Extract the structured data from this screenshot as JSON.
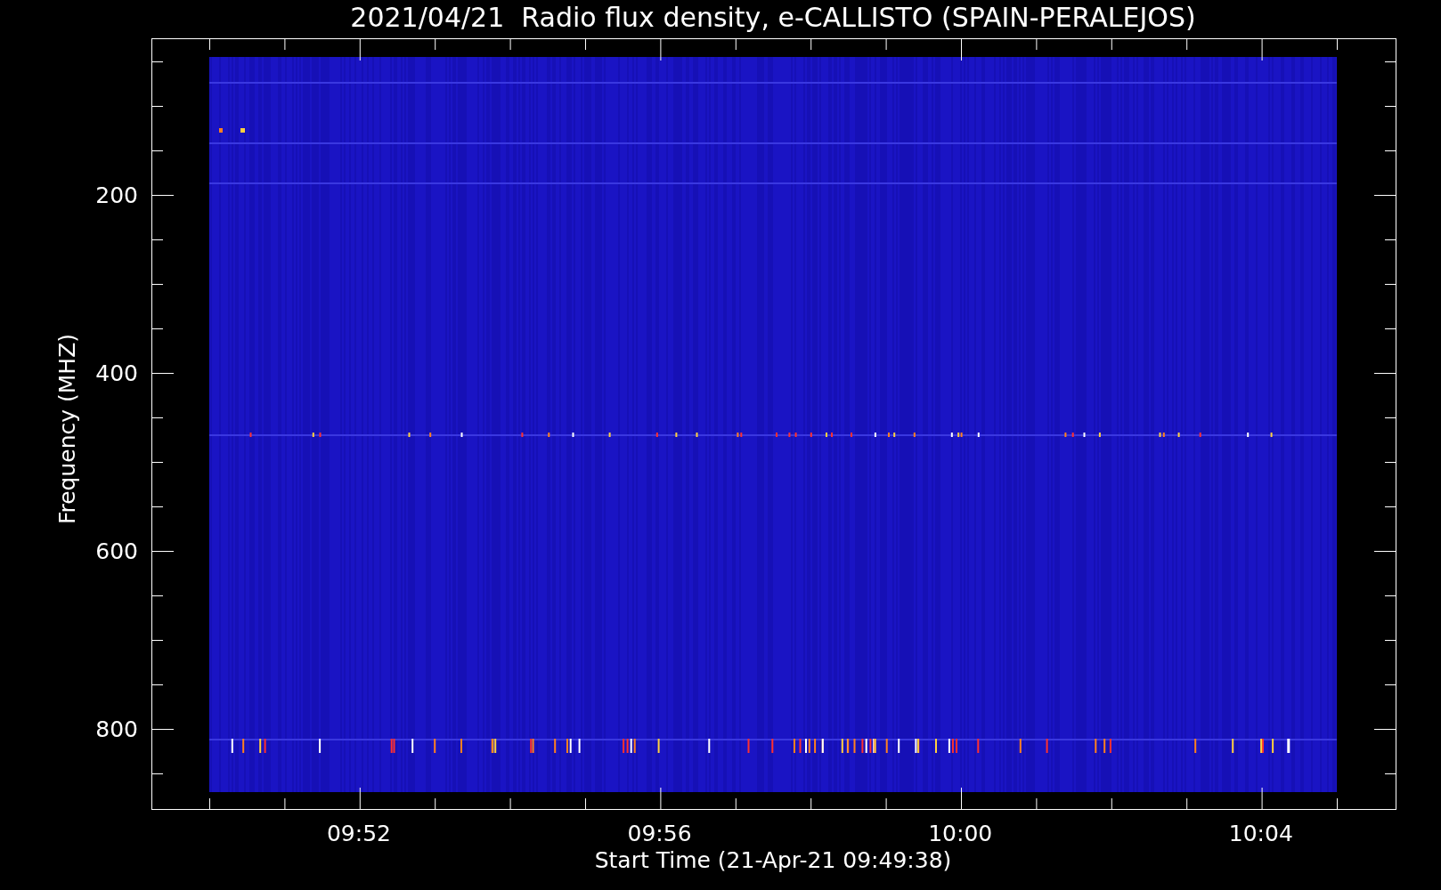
{
  "title": "2021/04/21  Radio flux density, e-CALLISTO (SPAIN-PERALEJOS)",
  "y_axis": {
    "label": "Frequency (MHZ)",
    "ticks": [
      "200",
      "400",
      "600",
      "800"
    ]
  },
  "x_axis": {
    "label": "Start Time (21-Apr-21 09:49:38)",
    "ticks": [
      "09:52",
      "09:56",
      "10:00",
      "10:04"
    ]
  }
}
